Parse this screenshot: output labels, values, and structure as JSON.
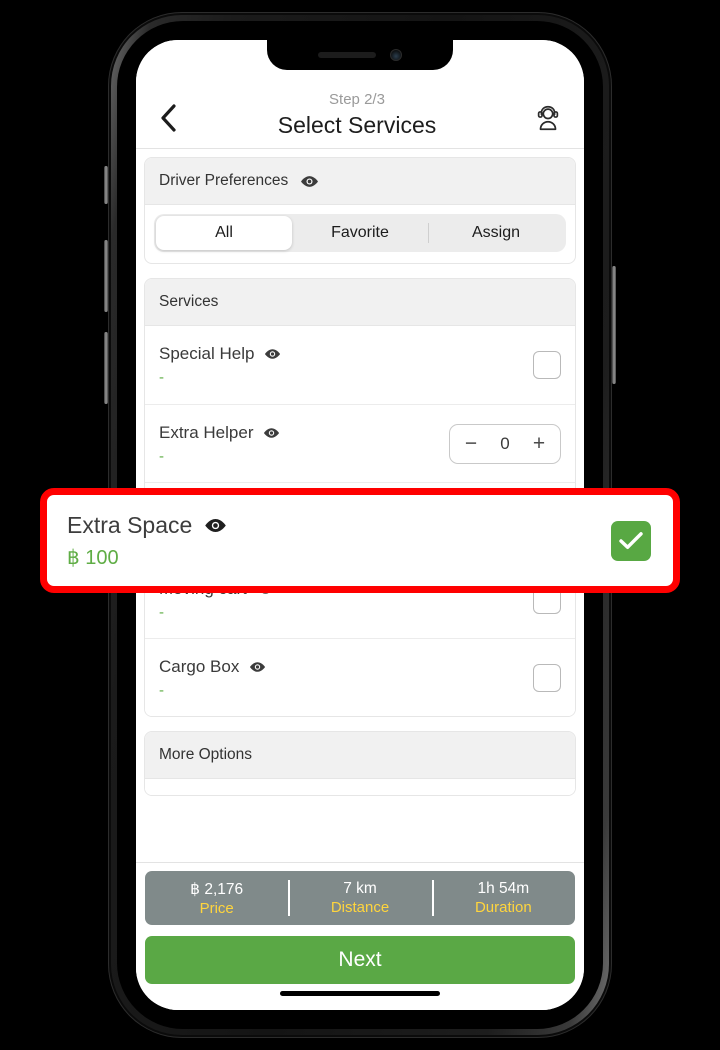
{
  "header": {
    "step_label": "Step 2/3",
    "title": "Select Services",
    "back_icon": "chevron-left-icon",
    "support_icon": "support-agent-icon"
  },
  "driver_preferences": {
    "section_title": "Driver Preferences",
    "eye_icon": "eye-icon",
    "segments": [
      {
        "label": "All",
        "selected": true
      },
      {
        "label": "Favorite",
        "selected": false
      },
      {
        "label": "Assign",
        "selected": false
      }
    ]
  },
  "services": {
    "section_title": "Services",
    "rows": [
      {
        "title": "Special Help",
        "price": "-",
        "control": "checkbox",
        "checked": false
      },
      {
        "title": "Extra Helper",
        "price": "-",
        "control": "stepper",
        "value": "0",
        "minus": "−",
        "plus": "+"
      },
      {
        "title": "Extra Space",
        "price": "฿ 100",
        "control": "checkbox",
        "checked": true
      },
      {
        "title": "Moving cart",
        "price": "-",
        "control": "checkbox",
        "checked": false
      },
      {
        "title": "Cargo Box",
        "price": "-",
        "control": "checkbox",
        "checked": false
      }
    ]
  },
  "more_options": {
    "section_title": "More Options"
  },
  "summary": {
    "cells": [
      {
        "value": "฿ 2,176",
        "label": "Price"
      },
      {
        "value": "7 km",
        "label": "Distance"
      },
      {
        "value": "1h 54m",
        "label": "Duration"
      }
    ]
  },
  "next_button": {
    "label": "Next"
  },
  "highlight": {
    "title": "Extra Space",
    "price": "฿ 100",
    "eye_icon": "eye-icon",
    "check_icon": "check-icon",
    "border_color": "#ff0000"
  },
  "colors": {
    "accent_green": "#5aa845",
    "price_green": "#5fad45",
    "summary_bg": "#808a8a",
    "summary_label": "#ffd53d",
    "highlight_red": "#ff0000"
  }
}
